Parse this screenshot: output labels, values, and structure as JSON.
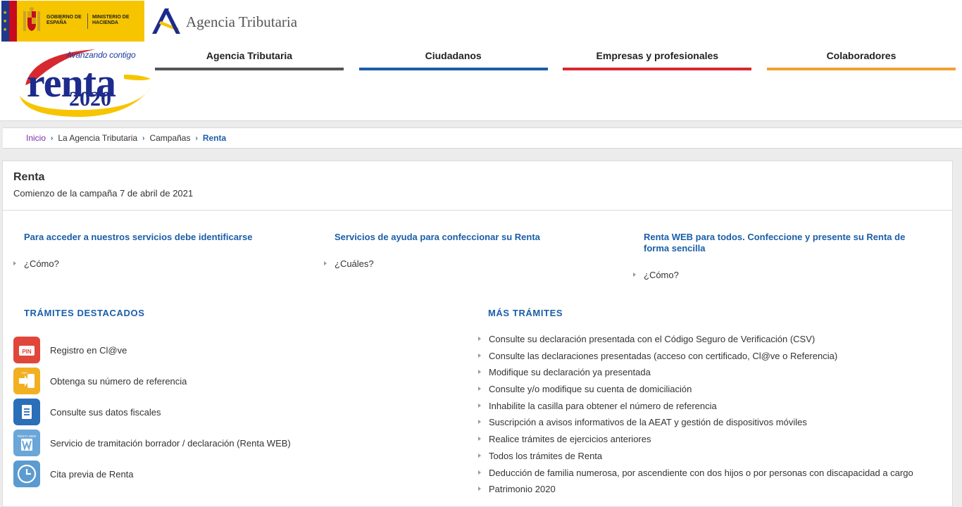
{
  "header": {
    "gov_text_1": "GOBIERNO DE ESPAÑA",
    "gov_text_2": "MINISTERIO DE HACIENDA",
    "agency_name": "Agencia Tributaria",
    "campaign_tagline": "Avanzando contigo",
    "campaign_word": "renta",
    "campaign_year": "2020"
  },
  "nav": [
    {
      "label": "Agencia Tributaria",
      "color": "#555555"
    },
    {
      "label": "Ciudadanos",
      "color": "#1a5ea8"
    },
    {
      "label": "Empresas y profesionales",
      "color": "#d7282f"
    },
    {
      "label": "Colaboradores",
      "color": "#f0a030"
    }
  ],
  "breadcrumb": {
    "items": [
      "Inicio",
      "La Agencia Tributaria",
      "Campañas",
      "Renta"
    ],
    "colors": [
      "#7b2fa3",
      "#333333",
      "#333333",
      "#1a5ea8"
    ]
  },
  "page": {
    "title": "Renta",
    "subtitle": "Comienzo de la campaña 7 de abril de 2021"
  },
  "info_blocks": [
    {
      "title": "Para acceder a nuestros servicios debe identificarse",
      "link": "¿Cómo?"
    },
    {
      "title": "Servicios de ayuda para confeccionar su Renta",
      "link": "¿Cuáles?"
    },
    {
      "title": "Renta WEB para todos. Confeccione y presente su Renta de forma sencilla",
      "link": "¿Cómo?"
    }
  ],
  "featured": {
    "title": "TRÁMITES DESTACADOS",
    "items": [
      {
        "label": "Registro en Cl@ve",
        "icon": "pin-icon",
        "color": "#e0463a"
      },
      {
        "label": "Obtenga su número de referencia",
        "icon": "mobile-reference-icon",
        "color": "#f2b021"
      },
      {
        "label": "Consulte sus datos fiscales",
        "icon": "document-icon",
        "color": "#2a6fb8"
      },
      {
        "label": "Servicio de tramitación borrador / declaración (Renta WEB)",
        "icon": "renta-web-icon",
        "color": "#6aa6d8"
      },
      {
        "label": "Cita previa de Renta",
        "icon": "clock-icon",
        "color": "#5b9bd0"
      }
    ],
    "icon_texts": [
      "PIN",
      "REF",
      "",
      "RENTA WEB",
      ""
    ]
  },
  "more": {
    "title": "MÁS TRÁMITES",
    "items": [
      "Consulte su declaración presentada con el Código Seguro de Verificación (CSV)",
      "Consulte las declaraciones presentadas (acceso con certificado, Cl@ve o Referencia)",
      "Modifique su declaración ya presentada",
      "Consulte y/o modifique su cuenta de domiciliación",
      "Inhabilite la casilla para obtener el número de referencia",
      "Suscripción a avisos informativos de la AEAT y gestión de dispositivos móviles",
      "Realice trámites de ejercicios anteriores",
      "Todos los trámites de Renta",
      "Deducción de familia numerosa, por ascendiente con dos hijos o por personas con discapacidad a cargo",
      "Patrimonio 2020"
    ]
  }
}
